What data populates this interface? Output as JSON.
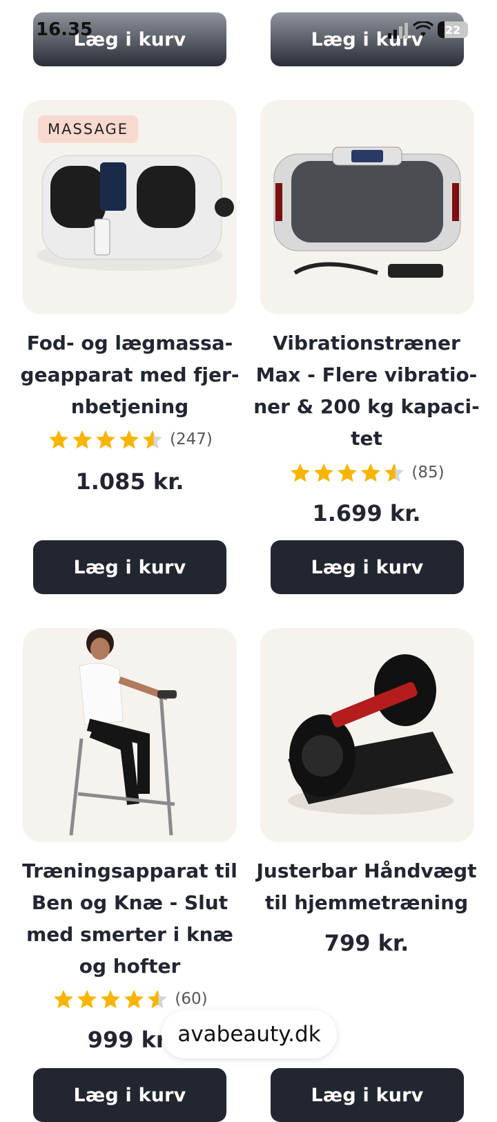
{
  "status_bar": {
    "time": "16.35",
    "battery": "22"
  },
  "buttons": {
    "add_to_cart": "Læg i kurv"
  },
  "products": [
    {
      "title": "Fod- og lægmassa- geapparat med fjer- nbetjening",
      "badge": "MASSAGE",
      "rating": 4.5,
      "reviews": "(247)",
      "price": "1.085 kr."
    },
    {
      "title": "Vibrationstræner Max - Flere vibratio- ner & 200 kg kapaci- tet",
      "rating": 4.5,
      "reviews": "(85)",
      "price": "1.699 kr."
    },
    {
      "title": "Træningsapparat til Ben og Knæ - Slut med smerter i knæ og hofter",
      "rating": 4.5,
      "reviews": "(60)",
      "price": "999 kr."
    },
    {
      "title": "Justerbar Håndvægt til hjemmetræning",
      "price": "799 kr."
    }
  ],
  "url_pill": "avabeauty.dk",
  "colors": {
    "button": "#22262f",
    "star": "#f7b500",
    "card_bg": "#f6f3ee",
    "badge_bg": "#f8d9cf"
  }
}
